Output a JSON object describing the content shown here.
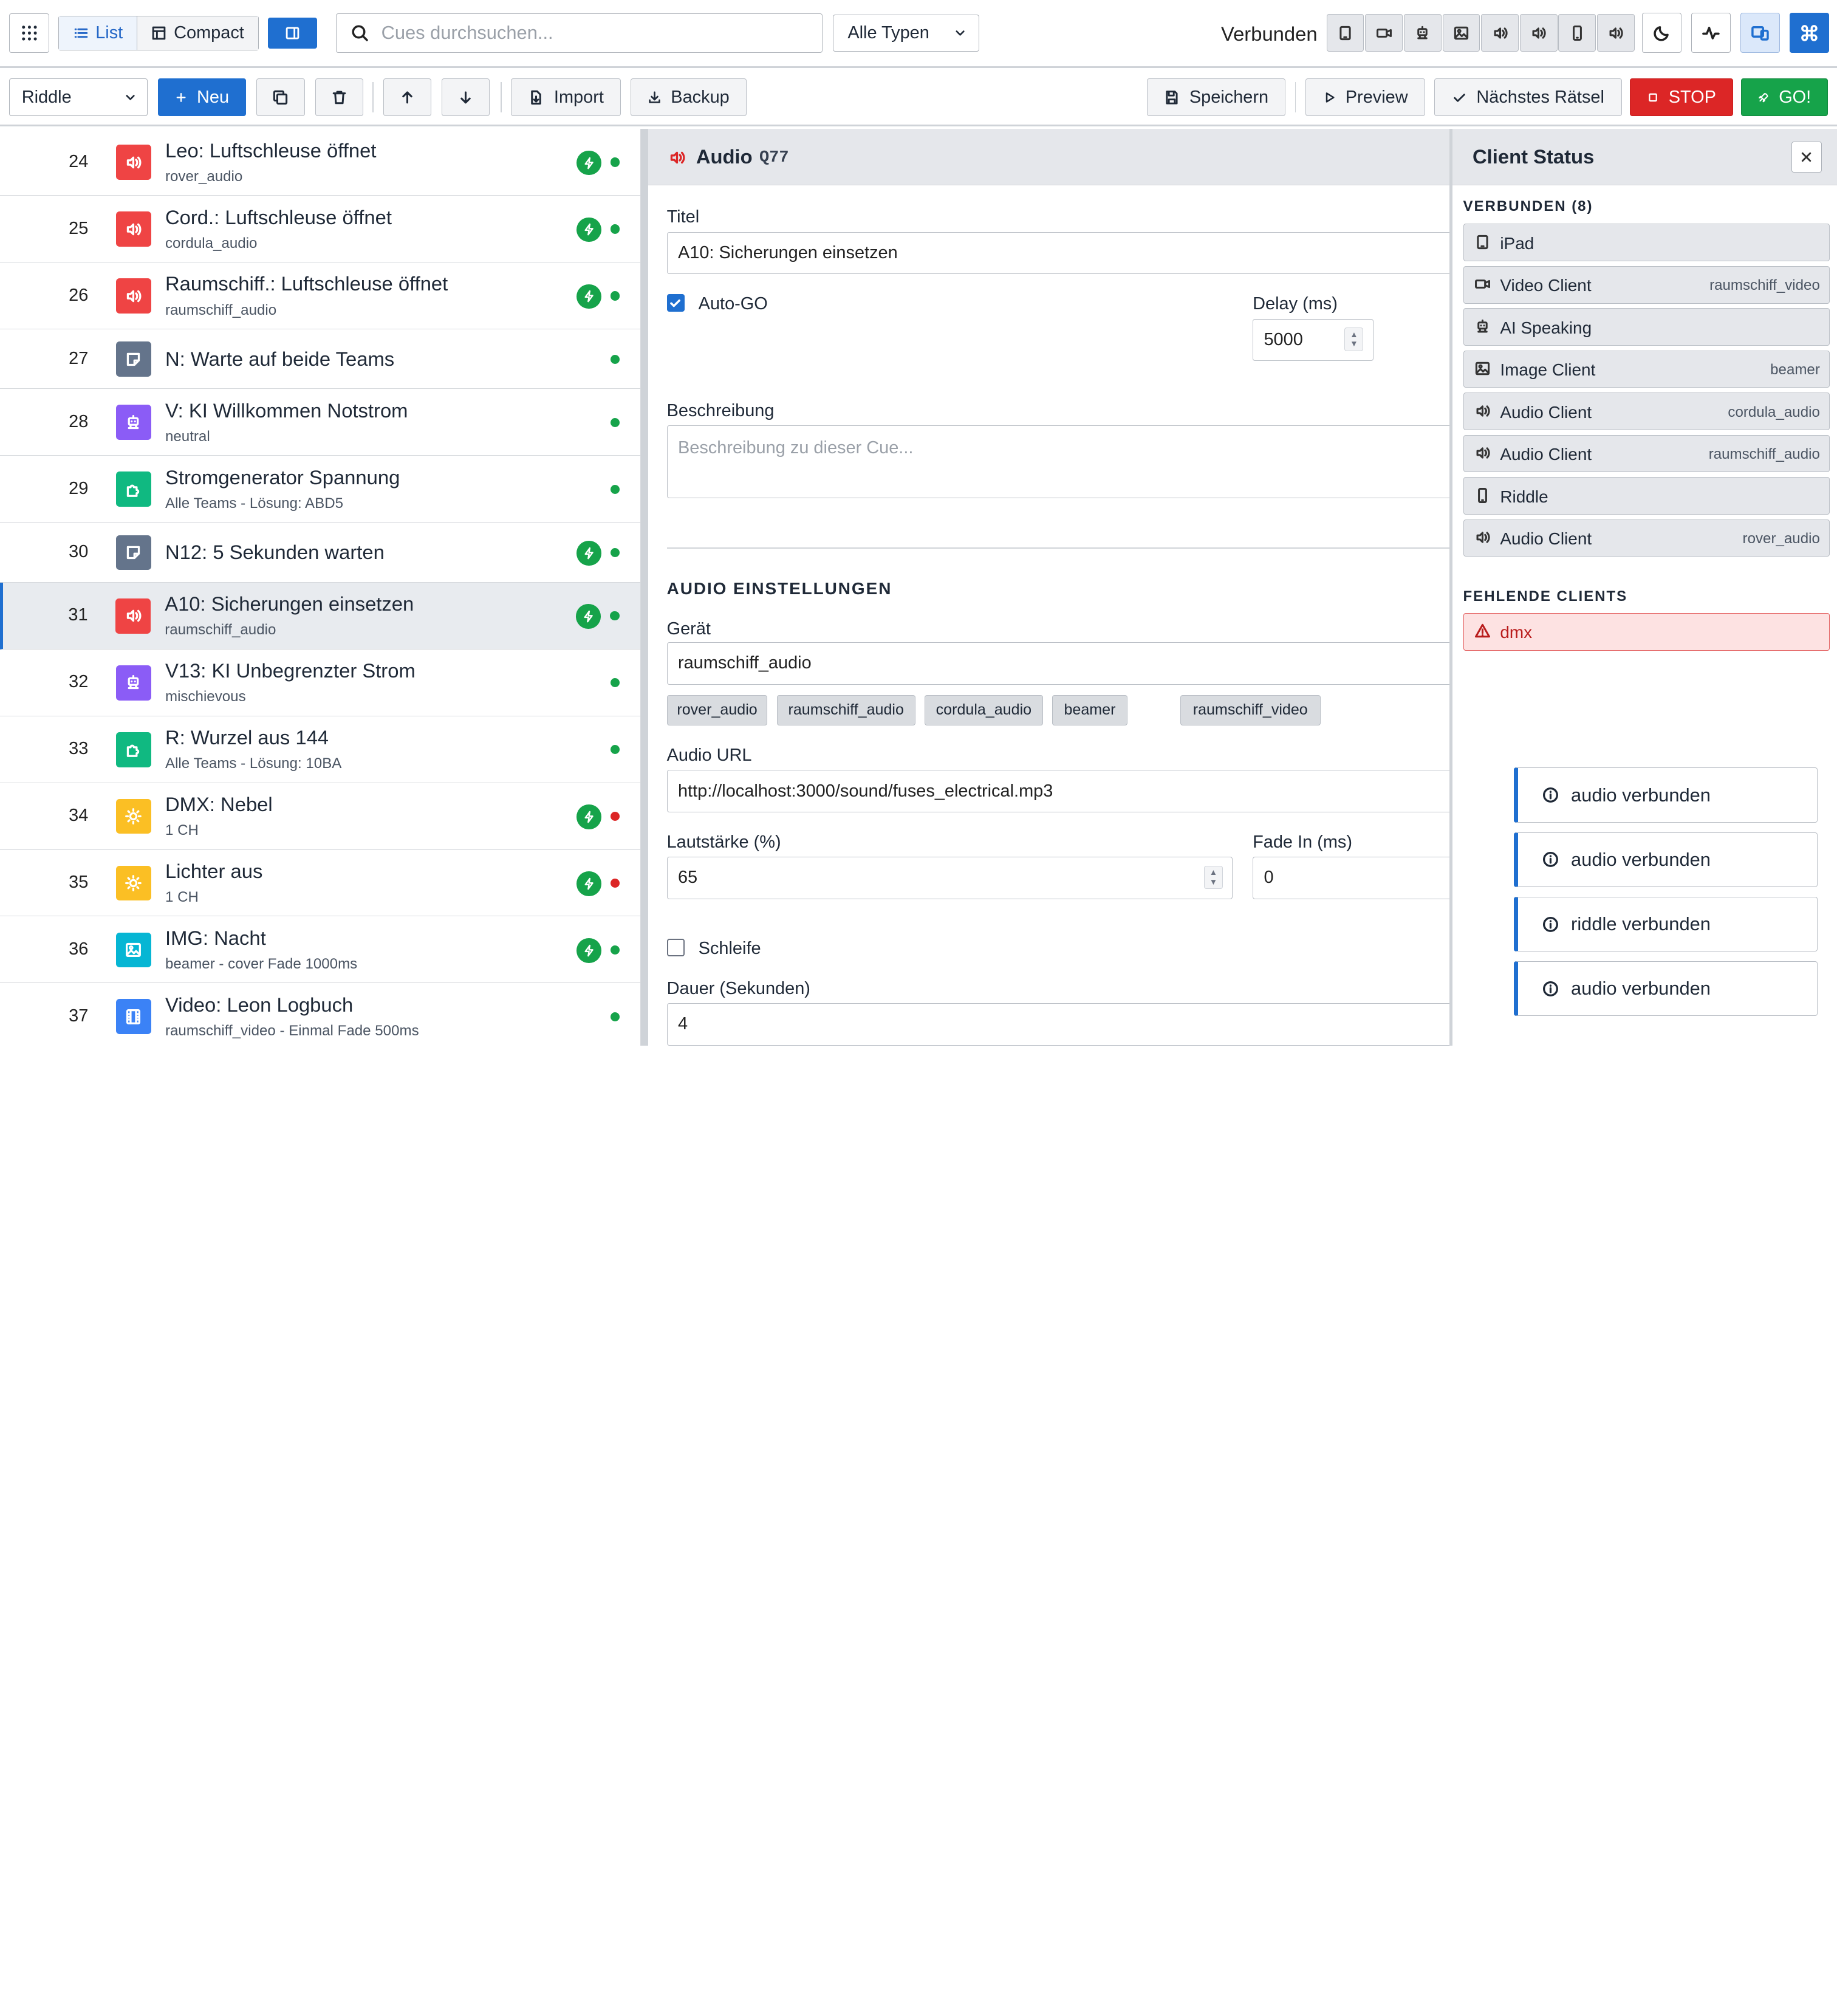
{
  "topbar": {
    "view_list": "List",
    "view_compact": "Compact",
    "search_placeholder": "Cues durchsuchen...",
    "type_filter": "Alle Typen",
    "connection": "Verbunden",
    "client_icons": [
      "tablet-icon",
      "video-icon",
      "robot-icon",
      "image-icon",
      "audio-icon",
      "audio-icon",
      "phone-icon",
      "audio-icon"
    ],
    "right_icons": [
      "moon-icon",
      "activity-icon",
      "devices-icon",
      "command-icon"
    ]
  },
  "toolbar": {
    "scene": "Riddle",
    "new_label": "Neu",
    "import_label": "Import",
    "backup_label": "Backup",
    "save_label": "Speichern",
    "preview_label": "Preview",
    "next_label": "Nächstes Rätsel",
    "stop_label": "STOP",
    "go_label": "GO!"
  },
  "cues": [
    {
      "num": "24",
      "type": "audio",
      "color": "#ef4444",
      "title": "Leo: Luftschleuse öffnet",
      "sub": "rover_audio",
      "auto": true,
      "status": "#16a34a",
      "selected": false
    },
    {
      "num": "25",
      "type": "audio",
      "color": "#ef4444",
      "title": "Cord.: Luftschleuse öffnet",
      "sub": "cordula_audio",
      "auto": true,
      "status": "#16a34a",
      "selected": false
    },
    {
      "num": "26",
      "type": "audio",
      "color": "#ef4444",
      "title": "Raumschiff.: Luftschleuse öffnet",
      "sub": "raumschiff_audio",
      "auto": true,
      "status": "#16a34a",
      "selected": false
    },
    {
      "num": "27",
      "type": "note",
      "color": "#64748b",
      "title": "N: Warte auf beide Teams",
      "sub": "",
      "auto": false,
      "status": "#16a34a",
      "selected": false
    },
    {
      "num": "28",
      "type": "voice",
      "color": "#8b5cf6",
      "title": "V: KI Willkommen Notstrom",
      "sub": "neutral",
      "auto": false,
      "status": "#16a34a",
      "selected": false
    },
    {
      "num": "29",
      "type": "puzzle",
      "color": "#10b981",
      "title": "Stromgenerator Spannung",
      "sub": "Alle Teams - Lösung: ABD5",
      "auto": false,
      "status": "#16a34a",
      "selected": false
    },
    {
      "num": "30",
      "type": "note",
      "color": "#64748b",
      "title": "N12: 5 Sekunden warten",
      "sub": "",
      "auto": true,
      "status": "#16a34a",
      "selected": false
    },
    {
      "num": "31",
      "type": "audio",
      "color": "#ef4444",
      "title": "A10: Sicherungen einsetzen",
      "sub": "raumschiff_audio",
      "auto": true,
      "status": "#16a34a",
      "selected": true
    },
    {
      "num": "32",
      "type": "voice",
      "color": "#8b5cf6",
      "title": "V13: KI Unbegrenzter Strom",
      "sub": "mischievous",
      "auto": false,
      "status": "#16a34a",
      "selected": false
    },
    {
      "num": "33",
      "type": "puzzle",
      "color": "#10b981",
      "title": "R: Wurzel aus 144",
      "sub": "Alle Teams - Lösung: 10BA",
      "auto": false,
      "status": "#16a34a",
      "selected": false
    },
    {
      "num": "34",
      "type": "light",
      "color": "#fbbf24",
      "title": "DMX: Nebel",
      "sub": "1 CH",
      "auto": true,
      "status": "#dc2626",
      "selected": false
    },
    {
      "num": "35",
      "type": "light",
      "color": "#fbbf24",
      "title": "Lichter aus",
      "sub": "1 CH",
      "auto": true,
      "status": "#dc2626",
      "selected": false
    },
    {
      "num": "36",
      "type": "image",
      "color": "#06b6d4",
      "title": "IMG: Nacht",
      "sub": "beamer - cover Fade 1000ms",
      "auto": true,
      "status": "#16a34a",
      "selected": false
    },
    {
      "num": "37",
      "type": "video",
      "color": "#3b82f6",
      "title": "Video: Leon Logbuch",
      "sub": "raumschiff_video - Einmal Fade 500ms",
      "auto": false,
      "status": "#16a34a",
      "selected": false
    }
  ],
  "editor": {
    "type_label": "Audio",
    "cue_id": "Q77",
    "title_label": "Titel",
    "title_value": "A10: Sicherungen einsetzen",
    "autogo_label": "Auto-GO",
    "autogo": true,
    "delay_label": "Delay (ms)",
    "delay_value": "5000",
    "desc_label": "Beschreibung",
    "desc_placeholder": "Beschreibung zu dieser Cue...",
    "section_audio": "AUDIO EINSTELLUNGEN",
    "device_label": "Gerät",
    "device_value": "raumschiff_audio",
    "device_chips": [
      "rover_audio",
      "raumschiff_audio",
      "cordula_audio",
      "beamer",
      "raumschiff_video"
    ],
    "url_label": "Audio URL",
    "url_value": "http://localhost:3000/sound/fuses_electrical.mp3",
    "volume_label": "Lautstärke (%)",
    "volume_value": "65",
    "fadein_label": "Fade In (ms)",
    "fadein_value": "0",
    "loop_label": "Schleife",
    "loop": false,
    "duration_label": "Dauer (Sekunden)",
    "duration_value": "4"
  },
  "status_panel": {
    "title": "Client Status",
    "connected_header": "VERBUNDEN (8)",
    "clients": [
      {
        "icon": "tablet-icon",
        "name": "iPad",
        "id": ""
      },
      {
        "icon": "video-icon",
        "name": "Video Client",
        "id": "raumschiff_video"
      },
      {
        "icon": "robot-icon",
        "name": "AI Speaking",
        "id": ""
      },
      {
        "icon": "image-icon",
        "name": "Image Client",
        "id": "beamer"
      },
      {
        "icon": "audio-icon",
        "name": "Audio Client",
        "id": "cordula_audio"
      },
      {
        "icon": "audio-icon",
        "name": "Audio Client",
        "id": "raumschiff_audio"
      },
      {
        "icon": "phone-icon",
        "name": "Riddle",
        "id": ""
      },
      {
        "icon": "audio-icon",
        "name": "Audio Client",
        "id": "rover_audio"
      }
    ],
    "missing_header": "FEHLENDE CLIENTS",
    "missing": [
      {
        "icon": "warning-icon",
        "name": "dmx"
      }
    ]
  },
  "toasts": [
    "audio verbunden",
    "audio verbunden",
    "riddle verbunden",
    "audio verbunden"
  ],
  "colors": {
    "accent": "#1f6fd0",
    "stop": "#dc2626",
    "go": "#16a34a",
    "ok": "#16a34a",
    "error": "#dc2626"
  }
}
